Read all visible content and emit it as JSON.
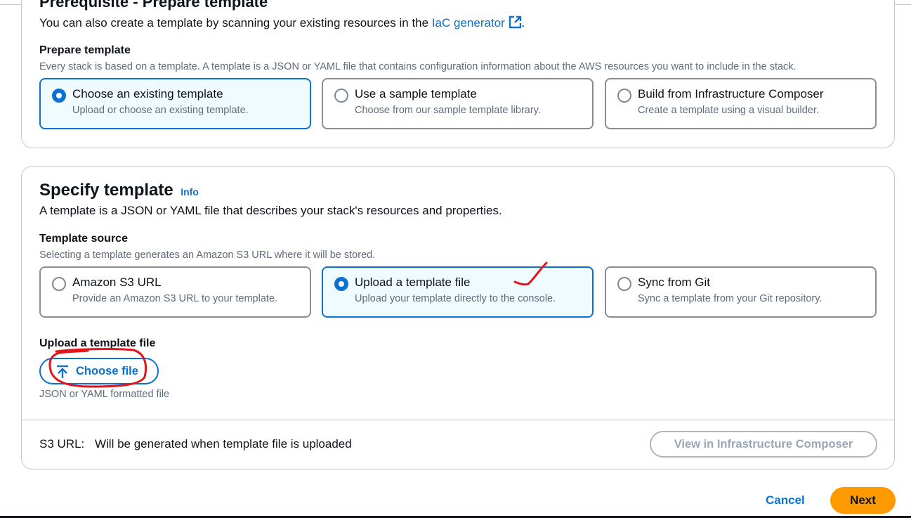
{
  "prerequisite": {
    "title": "Prerequisite - Prepare template",
    "intro_text": "You can also create a template by scanning your existing resources in the",
    "intro_link": "IaC generator",
    "intro_end": ".",
    "prepare_label": "Prepare template",
    "prepare_desc": "Every stack is based on a template. A template is a JSON or YAML file that contains configuration information about the AWS resources you want to include in the stack.",
    "options": [
      {
        "title": "Choose an existing template",
        "desc": "Upload or choose an existing template."
      },
      {
        "title": "Use a sample template",
        "desc": "Choose from our sample template library."
      },
      {
        "title": "Build from Infrastructure Composer",
        "desc": "Create a template using a visual builder."
      }
    ],
    "selected": "Choose an existing template"
  },
  "specify": {
    "title": "Specify template",
    "info": "Info",
    "desc": "A template is a JSON or YAML file that describes your stack's resources and properties.",
    "source_label": "Template source",
    "source_desc": "Selecting a template generates an Amazon S3 URL where it will be stored.",
    "sources": [
      {
        "title": "Amazon S3 URL",
        "desc": "Provide an Amazon S3 URL to your template."
      },
      {
        "title": "Upload a template file",
        "desc": "Upload your template directly to the console."
      },
      {
        "title": "Sync from Git",
        "desc": "Sync a template from your Git repository."
      }
    ],
    "selected": "Upload a template file",
    "upload_label": "Upload a template file",
    "choose_file": "Choose file",
    "file_hint": "JSON or YAML formatted file",
    "s3_label": "S3 URL:",
    "s3_value": "Will be generated when template file is uploaded",
    "composer_button": "View in Infrastructure Composer"
  },
  "footer": {
    "cancel": "Cancel",
    "next": "Next"
  },
  "colors": {
    "accent": "#0972d3",
    "primary_button": "#ff9900",
    "annotation": "#e0161c"
  },
  "icons": {
    "external_link": "external-link-icon",
    "upload": "upload-arrow-icon"
  }
}
